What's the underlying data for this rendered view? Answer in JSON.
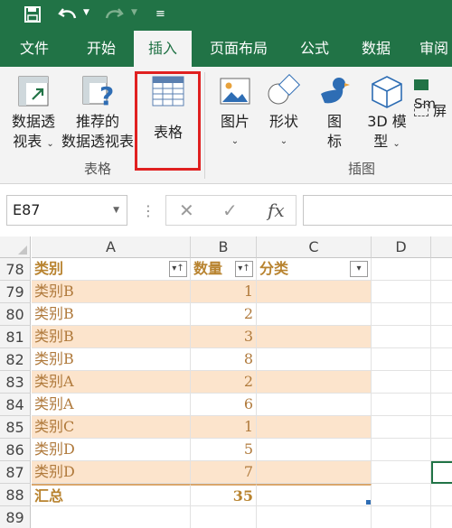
{
  "qat": {
    "save_icon": "save-icon",
    "undo_icon": "undo-icon",
    "redo_icon": "redo-icon",
    "customize_icon": "customize-icon"
  },
  "tabs": [
    "文件",
    "开始",
    "插入",
    "页面布局",
    "公式",
    "数据",
    "审阅"
  ],
  "active_tab": "插入",
  "ribbon": {
    "pivot_table": {
      "line1": "数据透",
      "line2": "视表"
    },
    "recommended_pivot": {
      "line1": "推荐的",
      "line2": "数据透视表"
    },
    "table": {
      "label": "表格"
    },
    "tables_group_label": "表格",
    "pictures": {
      "label": "图片"
    },
    "shapes": {
      "label": "形状"
    },
    "icons": {
      "line1": "图",
      "line2": "标"
    },
    "models3d": {
      "line1": "3D 模",
      "line2": "型"
    },
    "smartart": {
      "label": "Sm"
    },
    "screenshot": {
      "label": "屏"
    },
    "illustrations_group_label": "插图"
  },
  "formula_bar": {
    "name_box": "E87",
    "fx_label": "fx",
    "formula": ""
  },
  "columns": [
    "A",
    "B",
    "C",
    "D"
  ],
  "table": {
    "header_row": "78",
    "headers": [
      "类别",
      "数量",
      "分类"
    ],
    "rows": [
      {
        "row": "79",
        "category": "类别B",
        "qty": "1"
      },
      {
        "row": "80",
        "category": "类别B",
        "qty": "2"
      },
      {
        "row": "81",
        "category": "类别B",
        "qty": "3"
      },
      {
        "row": "82",
        "category": "类别B",
        "qty": "8"
      },
      {
        "row": "83",
        "category": "类别A",
        "qty": "2"
      },
      {
        "row": "84",
        "category": "类别A",
        "qty": "6"
      },
      {
        "row": "85",
        "category": "类别C",
        "qty": "1"
      },
      {
        "row": "86",
        "category": "类别D",
        "qty": "5"
      },
      {
        "row": "87",
        "category": "类别D",
        "qty": "7"
      }
    ],
    "total_row": {
      "row": "88",
      "label": "汇总",
      "qty": "35"
    },
    "extra_row": "89"
  },
  "colors": {
    "excel_green": "#217346",
    "band": "#fce4cc",
    "text": "#b07a3c",
    "highlight": "#e02020"
  }
}
